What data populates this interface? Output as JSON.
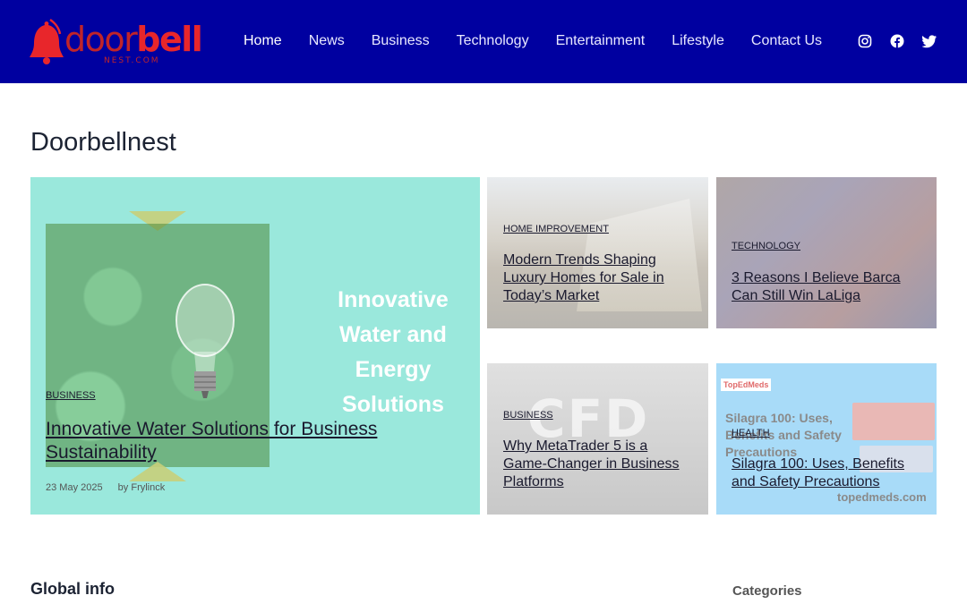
{
  "brand": {
    "logo_part1": "door",
    "logo_part2": "bell",
    "logo_sub": "NEST.COM"
  },
  "nav": {
    "items": [
      {
        "label": "Home",
        "active": true
      },
      {
        "label": "News"
      },
      {
        "label": "Business"
      },
      {
        "label": "Technology"
      },
      {
        "label": "Entertainment"
      },
      {
        "label": "Lifestyle"
      },
      {
        "label": "Contact Us"
      }
    ],
    "social": [
      "instagram-icon",
      "facebook-icon",
      "twitter-icon"
    ]
  },
  "page": {
    "title": "Doorbellnest"
  },
  "hero": {
    "image_tagline": "Innovative Water and Energy Solutions",
    "category": "BUSINESS",
    "title": "Innovative Water Solutions for Business Sustainability",
    "date": "23 May 2025",
    "author": "by Frylinck"
  },
  "cards": [
    {
      "category": "HOME IMPROVEMENT",
      "title": "Modern Trends Shaping Luxury Homes for Sale in Today’s Market"
    },
    {
      "category": "TECHNOLOGY",
      "title": "3 Reasons I Believe Barca Can Still Win LaLiga"
    },
    {
      "category": "BUSINESS",
      "title": "Why MetaTrader 5 is a Game-Changer in Business Platforms",
      "image_text": "CFD"
    },
    {
      "category": "HEALTH",
      "title": "Silagra 100: Uses, Benefits and Safety Precautions",
      "image_brand": "TopEdMeds",
      "image_title": "Silagra 100: Uses, Benefits and Safety Precautions",
      "image_site": "topedmeds.com"
    }
  ],
  "bottom": {
    "left_heading": "Global info",
    "right_heading": "Categories"
  },
  "colors": {
    "header_bg": "#0000a0",
    "hero_bg": "#9ae8dc",
    "logo_red": "#e8262b"
  }
}
